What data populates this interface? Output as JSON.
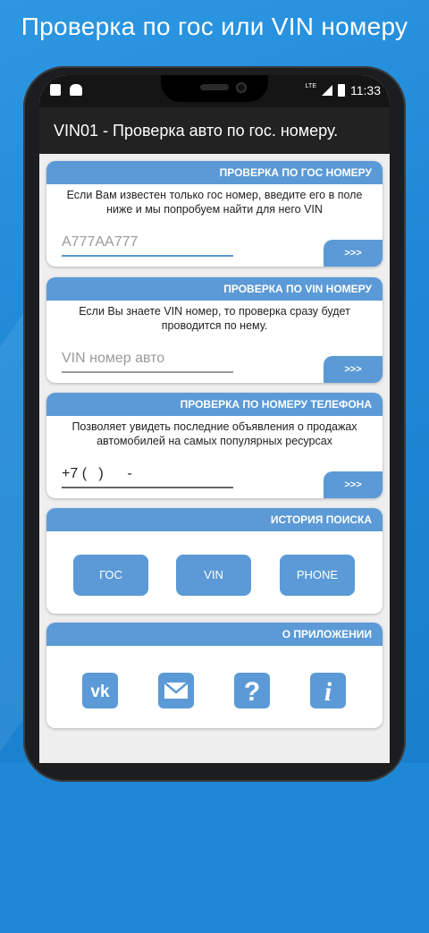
{
  "promo": {
    "title": "Проверка по гос или VIN номеру"
  },
  "status_bar": {
    "time": "11:33",
    "network": "LTE"
  },
  "app_bar": {
    "title": "VIN01 - Проверка авто по гос. номеру."
  },
  "cards": {
    "gos": {
      "header": "ПРОВЕРКА ПО ГОС НОМЕРУ",
      "desc": "Если Вам известен только гос номер, введите его в поле ниже и мы попробуем найти для него VIN",
      "placeholder": "A777AA777",
      "button": ">>>"
    },
    "vin": {
      "header": "ПРОВЕРКА ПО VIN НОМЕРУ",
      "desc": "Если Вы знаете VIN номер, то проверка сразу будет проводится по нему.",
      "placeholder": "VIN номер авто",
      "button": ">>>"
    },
    "phone": {
      "header": "ПРОВЕРКА ПО НОМЕРУ ТЕЛЕФОНА",
      "desc": "Позволяет увидеть последние объявления о продажах автомобилей на самых популярных ресурсах",
      "value": "+7 (   )      -",
      "button": ">>>"
    },
    "history": {
      "header": "ИСТОРИЯ ПОИСКА",
      "buttons": [
        "ГОС",
        "VIN",
        "PHONE"
      ]
    },
    "about": {
      "header": "О ПРИЛОЖЕНИИ",
      "icons": [
        "vk-icon",
        "mail-icon",
        "help-icon",
        "info-icon"
      ]
    }
  },
  "colors": {
    "accent": "#5b9ad6",
    "background": "#1e88d6",
    "appbar": "#222222"
  }
}
